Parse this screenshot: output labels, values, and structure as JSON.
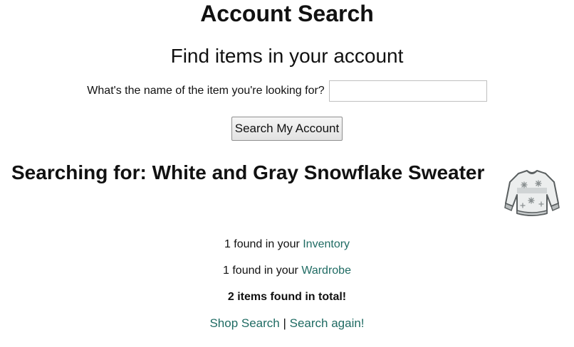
{
  "page": {
    "title": "Account Search",
    "subtitle": "Find items in your account"
  },
  "search": {
    "label": "What's the name of the item you're looking for?",
    "value": "",
    "placeholder": "",
    "button_label": "Search My Account"
  },
  "result": {
    "searching_prefix": "Searching for: ",
    "item_name": "White and Gray Snowflake Sweater",
    "item_image_icon": "sweater-icon",
    "inventory": {
      "count_text": "1 found in your ",
      "link_text": "Inventory"
    },
    "wardrobe": {
      "count_text": "1 found in your ",
      "link_text": "Wardrobe"
    },
    "total_text": "2 items found in total!"
  },
  "footer": {
    "shop_search_label": "Shop Search",
    "separator": " | ",
    "search_again_label": "Search again!"
  },
  "colors": {
    "link": "#1f6b63",
    "text": "#111111",
    "background": "#ffffff"
  }
}
